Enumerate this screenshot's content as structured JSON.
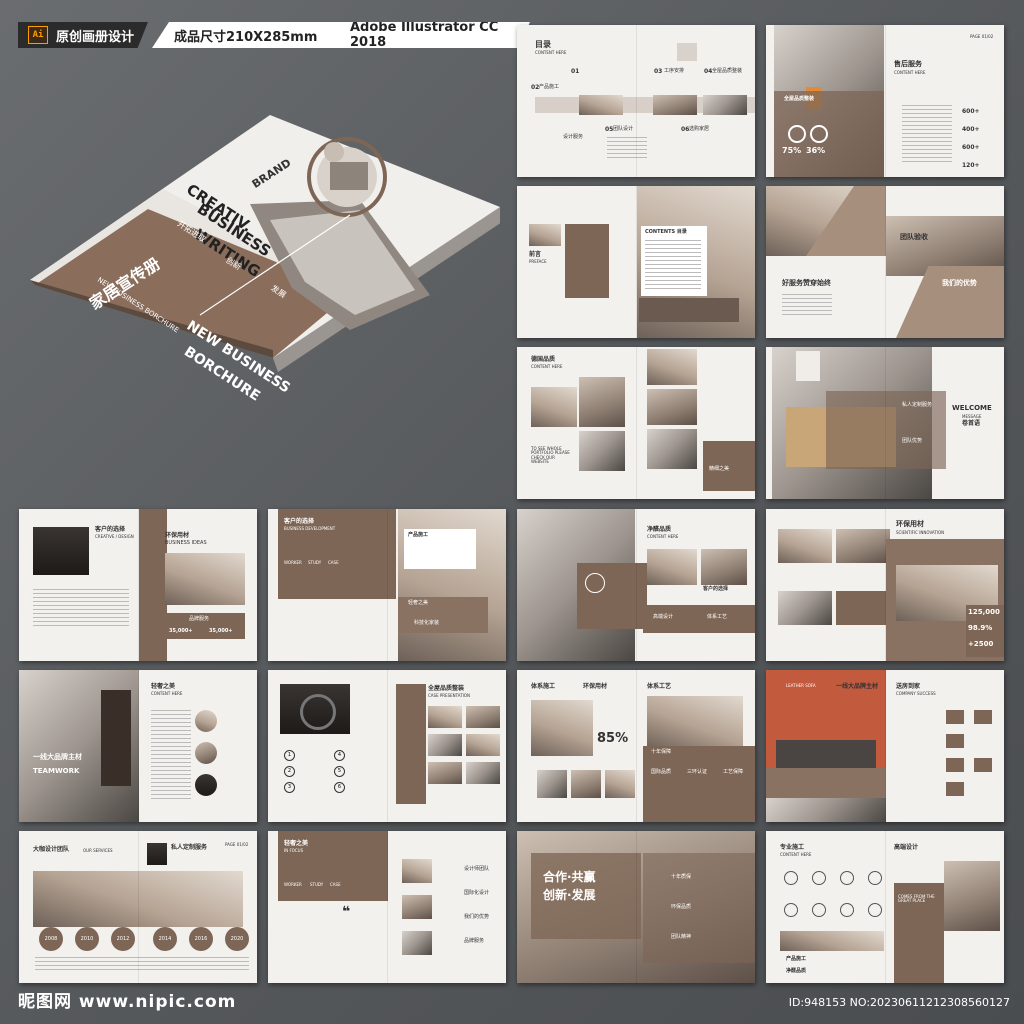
{
  "header": {
    "ai_label": "Ai",
    "original_label": "原创画册设计",
    "size_label": "成品尺寸210X285mm",
    "software_label": "Adobe Illustrator CC 2018"
  },
  "cover": {
    "brand": "BRAND",
    "title_line1": "CREATIV.",
    "title_line2": "BUSINESS",
    "title_line3": "WRITING",
    "cn_title": "家居宣传册",
    "en_sub": "NEW BUSINESS BORCHURE",
    "big_en_line1": "NEW BUSINESS",
    "big_en_line2": "BORCHURE",
    "tag1": "开拓进取",
    "tag2": "创新",
    "tag3": "发展"
  },
  "spreads": {
    "s1": {
      "title": "目录",
      "sub": "CONTENT HERE",
      "n1": "01",
      "n2": "02",
      "n3": "03",
      "n4": "04",
      "n5": "05",
      "n6": "06",
      "i1": "产品施工",
      "i2": "设计服务",
      "i3": "工序安排",
      "i4": "全屋品质整装",
      "i5": "团队设计",
      "i6": "选购家居"
    },
    "s2": {
      "title": "售后服务",
      "sub": "CONTENT HERE",
      "p1": "75%",
      "p2": "36%",
      "v1": "600+",
      "v2": "400+",
      "v3": "600+",
      "v4": "120+",
      "label": "全屋品质整装",
      "page": "PAGE 01/02"
    },
    "s3": {
      "title": "前言",
      "sub": "PREFACE",
      "contents": "CONTENTS 目录"
    },
    "s4": {
      "title": "团队验收",
      "left": "好服务赞穿始终",
      "right": "我们的优势"
    },
    "s5": {
      "title": "德国品质",
      "sub": "CONTENT HERE",
      "cta": "TO SEE WHOLE PORTFOLIO PLEASE CHECK OUR WEBSITE",
      "tag": "精细之美"
    },
    "s6": {
      "title": "WELCOME",
      "sub": "MESSAGE",
      "cn": "卷首语",
      "i1": "私人定制服务",
      "i2": "团队优势"
    },
    "s7": {
      "title": "客户的选择",
      "sub": "CREATIVE / DESIGN",
      "b1": "环保用材",
      "b2": "BUSINESS IDEAS",
      "stat1": "品牌服务",
      "stat2": "35,000+",
      "stat3": "35,000+"
    },
    "s8": {
      "title": "客户的选择",
      "sub": "BUSINESS DEVELOPMENT",
      "tab1": "WORKER",
      "tab2": "STUDY",
      "tab3": "CASE",
      "r1": "产品施工",
      "r2": "轻奢之美",
      "r3": "科技化家装"
    },
    "s9": {
      "title": "净醛品质",
      "sub": "CONTENT HERE",
      "l1": "高端设计",
      "l2": "体系工艺",
      "l3": "客户的选择"
    },
    "s10": {
      "title": "环保用材",
      "sub": "SCIENTIFIC INNOVATION",
      "n1": "125,000",
      "n2": "98.9%",
      "n3": "+2500"
    },
    "s11": {
      "title": "轻奢之美",
      "sub": "CONTENT HERE",
      "big": "一线大品牌主材",
      "big2": "TEAMWORK"
    },
    "s12": {
      "title": "全屋品质整装",
      "sub": "CASE PRESENTATION",
      "n1": "1",
      "n2": "2",
      "n3": "3",
      "n4": "4",
      "n5": "5",
      "n6": "6"
    },
    "s13": {
      "title": "体系施工",
      "t2": "环保用材",
      "t3": "体系工艺",
      "pct": "85%",
      "sub": "十年保障",
      "l1": "国际品质",
      "l2": "三环认证",
      "l3": "工艺保障"
    },
    "s14": {
      "title": "一线大品牌主材",
      "t2": "送房到家",
      "sub": "COMPANY SUCCESS",
      "tag": "LEATHER SOFA"
    },
    "s15": {
      "title": "大咖设计团队",
      "t2": "OUR SERVICES",
      "t3": "私人定制服务",
      "years": [
        "2008",
        "2010",
        "2012",
        "2014",
        "2016",
        "2020"
      ],
      "page": "PAGE 01/02"
    },
    "s16": {
      "title": "轻奢之美",
      "sub": "IN FOCUS",
      "tab1": "WORKER",
      "tab2": "STUDY",
      "tab3": "CASE",
      "l1": "设计师团队",
      "l2": "国际化设计",
      "l3": "我们的优势",
      "l4": "品牌服务"
    },
    "s17": {
      "line1": "合作·共赢",
      "line2": "创新·发展",
      "l1": "十年质保",
      "l2": "环保品质",
      "l3": "团队精神"
    },
    "s18": {
      "title": "专业施工",
      "sub": "CONTENT HERE",
      "t2": "高端设计",
      "tag": "COMES FROM THE GREAT PLACE",
      "l1": "产品施工",
      "l2": "净醛品质"
    }
  },
  "footer": {
    "logo": "昵图网 www.nipic.com",
    "id": "ID:948153 NO:20230611212308560127"
  },
  "colors": {
    "brown": "#7d6656",
    "background": "#5a5d60",
    "paper": "#f3f1ee"
  }
}
